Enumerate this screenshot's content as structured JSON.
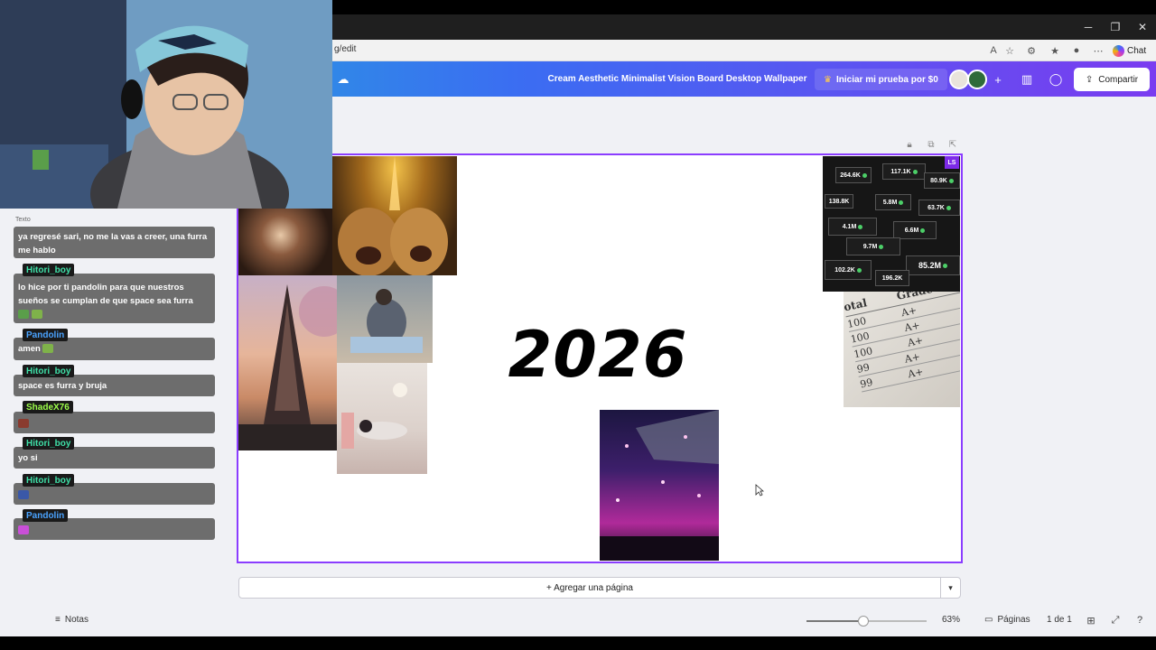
{
  "browser": {
    "url": "g/edit",
    "chat_label": "Chat",
    "icons": [
      "read-aloud-icon",
      "favorite-star-icon",
      "extensions-icon",
      "favorites-icon",
      "profile-icon",
      "more-icon"
    ]
  },
  "header": {
    "doc_title": "Cream Aesthetic Minimalist Vision Board Desktop Wallpaper",
    "trial_label": "Iniciar mi prueba por $0",
    "share_label": "Compartir"
  },
  "canvas": {
    "year_text": "2026",
    "badge": "LS",
    "stats": [
      "264.6K",
      "117.1K",
      "80.9K",
      "138.8K",
      "5.8M",
      "63.7K",
      "4.1M",
      "6.6M",
      "9.7M",
      "85.2M",
      "102.2K",
      "196.2K"
    ],
    "grades": {
      "headers": [
        "otal",
        "Grade"
      ],
      "rows": [
        [
          "100",
          "A+"
        ],
        [
          "100",
          "A+"
        ],
        [
          "100",
          "A+"
        ],
        [
          "99",
          "A+"
        ],
        [
          "99",
          "A+"
        ]
      ]
    }
  },
  "footer": {
    "add_page_label": "+ Agregar una página",
    "notes_label": "Notas",
    "zoom_label": "63%",
    "zoom_fraction": 0.47,
    "pages_label": "Páginas",
    "page_count": "1 de 1"
  },
  "chat": {
    "ghost_labels": [
      "Texto"
    ],
    "messages": [
      {
        "user": "",
        "text": "ya regresé sari, no me la vas a creer, una furra me hablo",
        "color": "#ffffff"
      },
      {
        "user": "Hitori_boy",
        "text": "lo hice por ti pandolin para que nuestros sueños se cumplan de que space sea furra",
        "color": "#3fe0a8"
      },
      {
        "user": "Pandolin",
        "text": "amen",
        "color": "#4aa3ff"
      },
      {
        "user": "Hitori_boy",
        "text": "space es furra y bruja",
        "color": "#3fe0a8"
      },
      {
        "user": "ShadeX76",
        "text": "",
        "color": "#9dff4a"
      },
      {
        "user": "Hitori_boy",
        "text": "yo si",
        "color": "#3fe0a8"
      },
      {
        "user": "Hitori_boy",
        "text": "",
        "color": "#3fe0a8"
      },
      {
        "user": "Pandolin",
        "text": "",
        "color": "#4aa3ff"
      }
    ]
  },
  "colors": {
    "accent": "#8b3dff",
    "header_gradient_start": "#1fb3d6",
    "header_gradient_end": "#7a3cf0"
  }
}
